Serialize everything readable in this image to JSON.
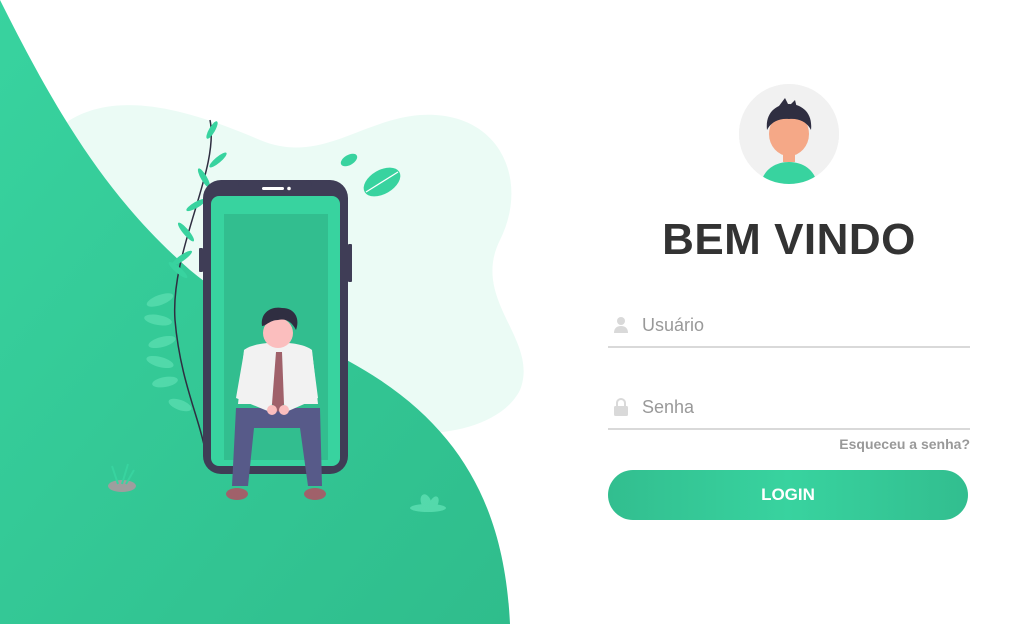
{
  "theme": {
    "accent": "#38d39f",
    "accent_dark": "#32be8f",
    "text": "#333333",
    "muted": "#999999"
  },
  "header": {
    "title": "BEM VINDO"
  },
  "form": {
    "username_placeholder": "Usuário",
    "username_value": "",
    "username_icon": "user-icon",
    "password_placeholder": "Senha",
    "password_value": "",
    "password_icon": "lock-icon",
    "forgot_label": "Esqueceu a senha?",
    "login_label": "LOGIN"
  }
}
